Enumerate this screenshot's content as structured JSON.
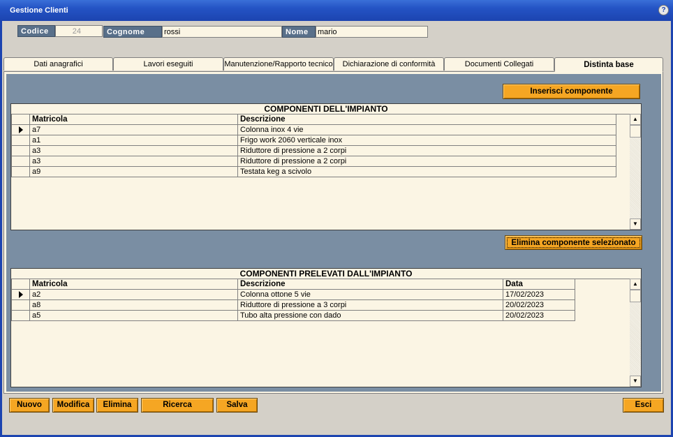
{
  "window": {
    "title": "Gestione Clienti",
    "help_glyph": "?"
  },
  "header": {
    "codice_label": "Codice",
    "codice_value": "24",
    "cognome_label": "Cognome",
    "cognome_value": "rossi",
    "nome_label": "Nome",
    "nome_value": "mario"
  },
  "tabs": [
    {
      "label": "Dati anagrafici"
    },
    {
      "label": "Lavori eseguiti"
    },
    {
      "label": "Manutenzione/Rapporto tecnico"
    },
    {
      "label": "Dichiarazione di conformità"
    },
    {
      "label": "Documenti Collegati"
    },
    {
      "label": "Distinta base",
      "active": true
    }
  ],
  "distinta": {
    "insert_label": "Inserisci componente",
    "delete_label": "Elimina componente selezionato",
    "components": {
      "title": "COMPONENTI DELL'IMPIANTO",
      "columns": [
        "Matricola",
        "Descrizione"
      ],
      "rows": [
        [
          "a7",
          "Colonna inox 4 vie"
        ],
        [
          "a1",
          "Frigo work 2060 verticale inox"
        ],
        [
          "a3",
          "Riduttore di pressione a 2 corpi"
        ],
        [
          "a3",
          "Riduttore di pressione a 2 corpi"
        ],
        [
          "a9",
          "Testata keg a scivolo"
        ]
      ]
    },
    "removed": {
      "title": "COMPONENTI PRELEVATI DALL'IMPIANTO",
      "columns": [
        "Matricola",
        "Descrizione",
        "Data"
      ],
      "rows": [
        [
          "a2",
          "Colonna ottone 5 vie",
          "17/02/2023"
        ],
        [
          "a8",
          "Riduttore di pressione a 3 corpi",
          "20/02/2023"
        ],
        [
          "a5",
          "Tubo alta pressione con dado",
          "20/02/2023"
        ]
      ]
    }
  },
  "footer": {
    "nuovo": "Nuovo",
    "modifica": "Modifica",
    "elimina": "Elimina",
    "ricerca": "Ricerca",
    "salva": "Salva",
    "esci": "Esci"
  },
  "colors": {
    "accent": "#f5a623",
    "panel": "#7a8ea3",
    "title_bar": "#2453c4"
  }
}
